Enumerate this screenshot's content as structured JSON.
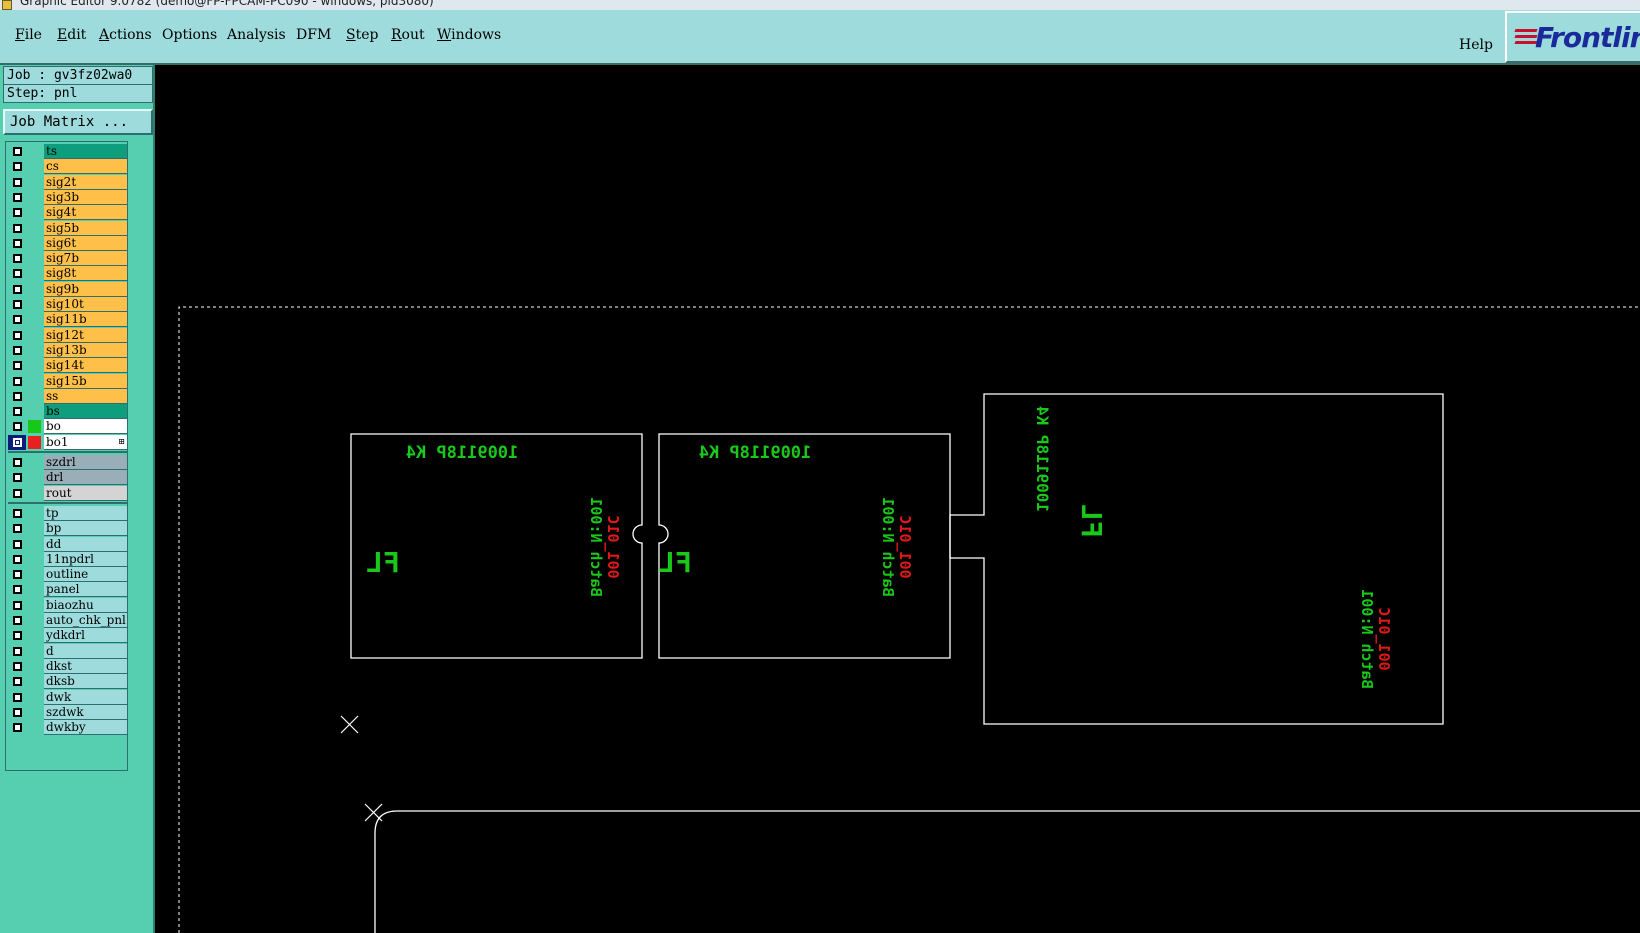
{
  "window": {
    "title": "Graphic Editor 9.0782 (demo@FP-FPCAM-PC090 - windows, pid3080)"
  },
  "menubar": {
    "items": [
      {
        "label": "File",
        "accel": "F",
        "rest": "ile"
      },
      {
        "label": "Edit",
        "accel": "E",
        "rest": "dit"
      },
      {
        "label": "Actions",
        "accel": "A",
        "rest": "ctions"
      },
      {
        "label": "Options",
        "accel": "",
        "rest": "Options"
      },
      {
        "label": "Analysis",
        "accel": "",
        "rest": "Analysis"
      },
      {
        "label": "DFM",
        "accel": "",
        "rest": "DFM"
      },
      {
        "label": "Step",
        "accel": "S",
        "rest": "tep"
      },
      {
        "label": "Rout",
        "accel": "R",
        "rest": "out"
      },
      {
        "label": "Windows",
        "accel": "W",
        "rest": "indows"
      }
    ],
    "help": "Help",
    "logo": "Frontline"
  },
  "info": {
    "job": "Job : gv3fz02wa0",
    "step": "Step: pnl",
    "job_matrix": "Job Matrix ..."
  },
  "layers": {
    "group1": [
      {
        "name": "ts",
        "color": "#0e9e7e"
      },
      {
        "name": "cs",
        "color": "#ffc04a"
      },
      {
        "name": "sig2t",
        "color": "#ffc04a"
      },
      {
        "name": "sig3b",
        "color": "#ffc04a"
      },
      {
        "name": "sig4t",
        "color": "#ffc04a"
      },
      {
        "name": "sig5b",
        "color": "#ffc04a"
      },
      {
        "name": "sig6t",
        "color": "#ffc04a"
      },
      {
        "name": "sig7b",
        "color": "#ffc04a"
      },
      {
        "name": "sig8t",
        "color": "#ffc04a"
      },
      {
        "name": "sig9b",
        "color": "#ffc04a"
      },
      {
        "name": "sig10t",
        "color": "#ffc04a"
      },
      {
        "name": "sig11b",
        "color": "#ffc04a"
      },
      {
        "name": "sig12t",
        "color": "#ffc04a"
      },
      {
        "name": "sig13b",
        "color": "#ffc04a"
      },
      {
        "name": "sig14t",
        "color": "#ffc04a"
      },
      {
        "name": "sig15b",
        "color": "#ffc04a"
      },
      {
        "name": "ss",
        "color": "#ffc04a"
      },
      {
        "name": "bs",
        "color": "#0e9e7e"
      },
      {
        "name": "bo",
        "color": "#ffffff",
        "swatch": "#18c818"
      },
      {
        "name": "bo1",
        "color": "#ffffff",
        "swatch": "#e82020",
        "active": true,
        "mark": "⊞"
      }
    ],
    "group2": [
      {
        "name": "szdrl",
        "color": "#9aaeb8"
      },
      {
        "name": "drl",
        "color": "#9aaeb8"
      },
      {
        "name": "rout",
        "color": "#d4d4d4"
      }
    ],
    "group3": [
      {
        "name": "tp",
        "color": "#9edbdc"
      },
      {
        "name": "bp",
        "color": "#9edbdc"
      },
      {
        "name": "dd",
        "color": "#9edbdc"
      },
      {
        "name": "11npdrl",
        "color": "#9edbdc"
      },
      {
        "name": "outline",
        "color": "#9edbdc"
      },
      {
        "name": "panel",
        "color": "#9edbdc"
      },
      {
        "name": "biaozhu",
        "color": "#9edbdc"
      },
      {
        "name": "auto_chk_pnl",
        "color": "#9edbdc"
      },
      {
        "name": "ydkdrl",
        "color": "#9edbdc"
      },
      {
        "name": "d",
        "color": "#9edbdc"
      },
      {
        "name": "dkst",
        "color": "#9edbdc"
      },
      {
        "name": "dksb",
        "color": "#9edbdc"
      },
      {
        "name": "dwk",
        "color": "#9edbdc"
      },
      {
        "name": "szdwk",
        "color": "#9edbdc"
      },
      {
        "name": "dwkby",
        "color": "#9edbdc"
      }
    ]
  },
  "board": {
    "part_number": "1009118P K4",
    "batch_label": "Batch N:001",
    "batch_value": "001_01C",
    "marker": "FL",
    "colors": {
      "text_green": "#19c819",
      "text_red": "#e01818",
      "outline": "#ffffff"
    }
  }
}
